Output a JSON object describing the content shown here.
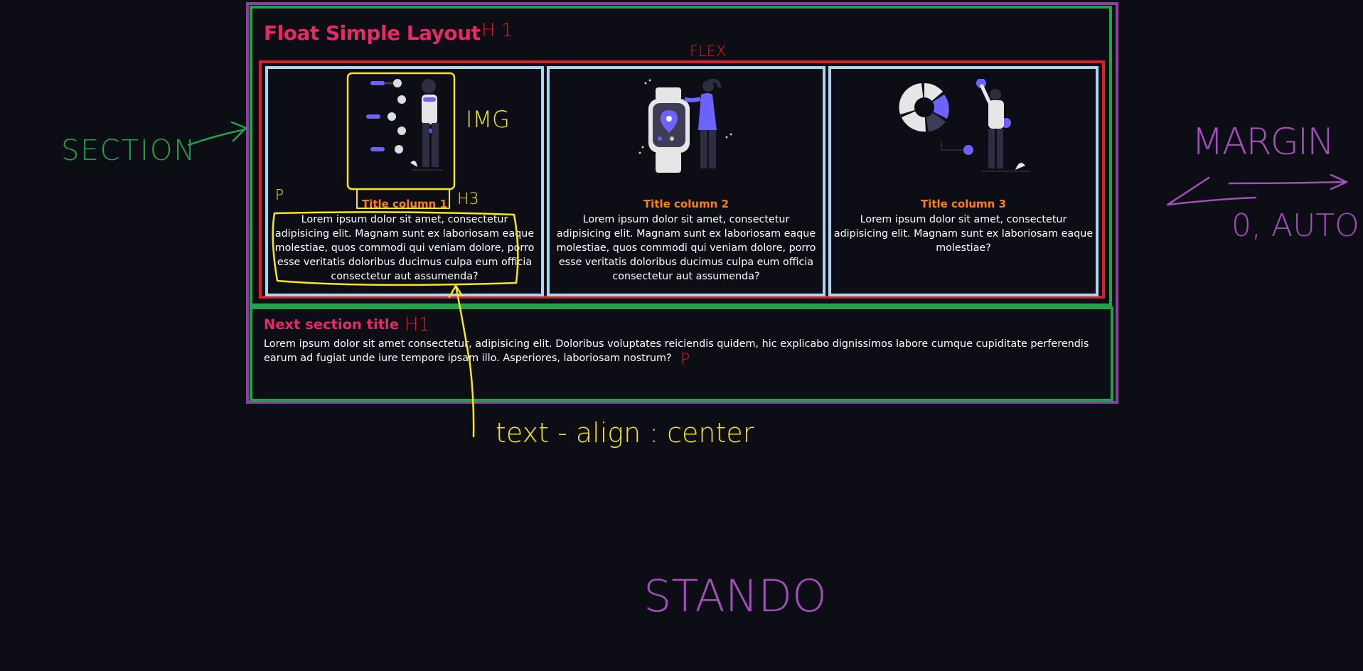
{
  "page": {
    "title": "Float Simple Layout",
    "columns": [
      {
        "title": "Title column 1",
        "text_lines": [
          "Lorem ipsum dolor sit amet, consectetur",
          "adipisicing elit. Magnam sunt ex laboriosam eaque",
          "molestiae, quos commodi qui veniam dolore, porro",
          "esse veritatis doloribus ducimus culpa eum officia",
          "consectetur aut assumenda?"
        ]
      },
      {
        "title": "Title column 2",
        "text_lines": [
          "Lorem ipsum dolor sit amet, consectetur",
          "adipisicing elit. Magnam sunt ex laboriosam eaque",
          "molestiae, quos commodi qui veniam dolore, porro",
          "esse veritatis doloribus ducimus culpa eum officia",
          "consectetur aut assumenda?"
        ]
      },
      {
        "title": "Title column 3",
        "text_lines": [
          "Lorem ipsum dolor sit amet, consectetur",
          "adipisicing elit. Magnam sunt ex laboriosam eaque",
          "molestiae?"
        ]
      }
    ],
    "next_section": {
      "title": "Next section title",
      "text_lines": [
        "Lorem ipsum dolor sit amet consectetur, adipisicing elit. Doloribus voluptates reiciendis quidem, hic explicabo dignissimos labore cumque cupiditate perferendis",
        "earum ad fugiat unde iure tempore ipsam illo. Asperiores, laboriosam nostrum?"
      ]
    }
  },
  "annotations": {
    "h1_mark": "H 1",
    "flex": "FLEX",
    "img": "IMG",
    "p_mark": "P",
    "h3": "H3",
    "section": "SECTION",
    "margin": "MARGIN",
    "margin_value": "0, AUTO",
    "h1_next": "H1",
    "p_next": "P",
    "text_align": "text - align : center",
    "stando": "STANDO"
  },
  "colors": {
    "background": "#0d0d15",
    "heading_pink": "#e52a67",
    "column_title_orange": "#ff7f11",
    "accent_purple": "#6c63ff",
    "outline_purple": "#8b3fa0",
    "outline_green": "#21a34a",
    "outline_red": "#e01d2b",
    "outline_lightblue": "#a9d7ee",
    "annotation_yellow": "#f5e71a"
  }
}
